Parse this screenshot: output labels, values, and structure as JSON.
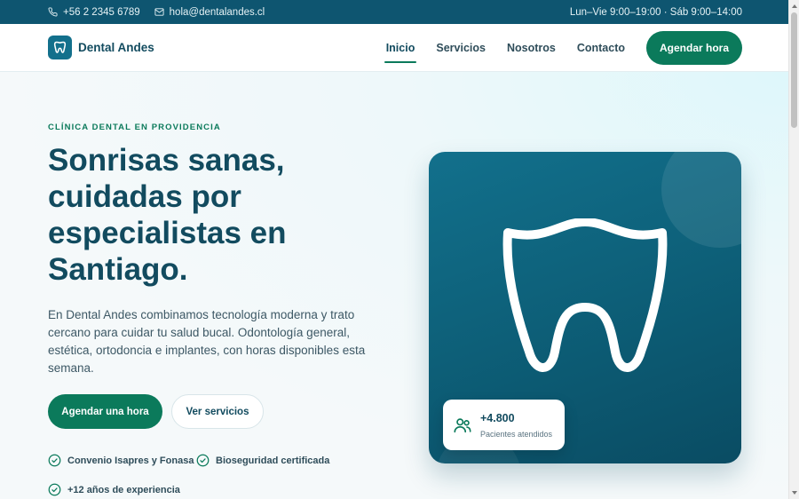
{
  "topbar": {
    "phone": "+56 2 2345 6789",
    "email": "hola@dentalandes.cl",
    "hours": "Lun–Vie 9:00–19:00 · Sáb 9:00–14:00"
  },
  "header": {
    "brand": "Dental Andes",
    "nav": [
      {
        "label": "Inicio",
        "active": true
      },
      {
        "label": "Servicios",
        "active": false
      },
      {
        "label": "Nosotros",
        "active": false
      },
      {
        "label": "Contacto",
        "active": false
      }
    ],
    "cta_label": "Agendar hora"
  },
  "hero": {
    "eyebrow": "CLÍNICA DENTAL EN PROVIDENCIA",
    "title_lines": [
      "Sonrisas sanas,",
      "cuidadas por",
      "especialistas en",
      "Santiago."
    ],
    "description": "En Dental Andes combinamos tecnología moderna y trato cercano para cuidar tu salud bucal. Odontología general, estética, ortodoncia e implantes, con horas disponibles esta semana.",
    "primary_button": "Agendar una hora",
    "secondary_button": "Ver servicios",
    "features": [
      "Convenio Isapres y Fonasa",
      "Bioseguridad certificada",
      "+12 años de experiencia"
    ]
  },
  "stat": {
    "value": "+4.800",
    "label": "Pacientes atendidos"
  },
  "colors": {
    "topbar": "#0e5570",
    "brand": "#124b5f",
    "accent": "#0b7a5b",
    "card": "#12708c"
  },
  "icons": {
    "phone": "phone-icon",
    "email": "mail-icon",
    "logo": "tooth-icon",
    "feature": "check-circle-icon",
    "stat": "users-icon"
  }
}
